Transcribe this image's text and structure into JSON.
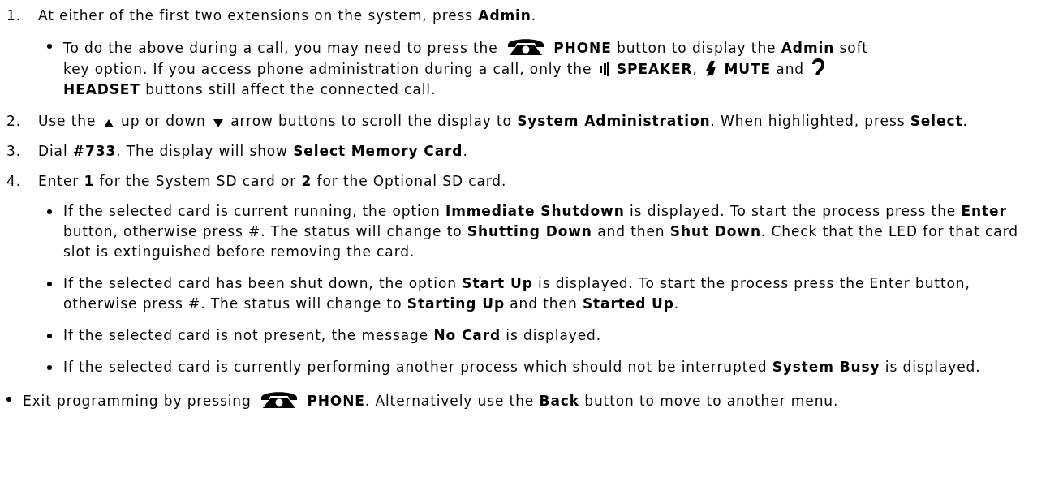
{
  "steps": [
    {
      "number": "1.",
      "segments": [
        {
          "kind": "text",
          "text": "At either of the first two extensions on the system, press **Admin**."
        }
      ],
      "notes": [
        {
          "segments": [
            {
              "kind": "text",
              "text": "To do the above during a call, you may need to press the"
            },
            {
              "kind": "phone_key"
            },
            {
              "kind": "text",
              "text": "**PHONE** button to display the **Admin** soft"
            },
            {
              "kind": "text",
              "text": "key option. If you access phone administration during a call, only the"
            },
            {
              "kind": "speaker_key"
            },
            {
              "kind": "text",
              "text": "**SPEAKER**,"
            },
            {
              "kind": "mute_key"
            },
            {
              "kind": "text",
              "text": "**MUTE** and"
            },
            {
              "kind": "headset_key"
            },
            {
              "kind": "text",
              "text": "**HEADSET** buttons still affect the connected call."
            }
          ]
        }
      ]
    },
    {
      "number": "2.",
      "segments": [
        {
          "kind": "text",
          "text": "Use the"
        },
        {
          "kind": "up_key"
        },
        {
          "kind": "text",
          "text": "up or down"
        },
        {
          "kind": "down_key"
        },
        {
          "kind": "text",
          "text": "arrow buttons to scroll the display to **System Administration**. When highlighted,"
        },
        {
          "kind": "text",
          "text": "press **Select**."
        }
      ]
    },
    {
      "number": "3.",
      "segments": [
        {
          "kind": "text",
          "text": "Dial **#733**. The display will show **Select Memory Card**."
        }
      ]
    },
    {
      "number": "4.",
      "segments": [
        {
          "kind": "text",
          "text": "Enter **1** for the System SD card or **2** for the Optional SD card."
        }
      ],
      "notes": [
        {
          "segments": [
            {
              "kind": "text",
              "text": "If the selected card is current running, the option **Immediate Shutdown** is displayed. To start the process press the **Enter** button, otherwise press #. The status will change to **Shutting Down** and then **Shut Down**. Check that the LED for that card slot is extinguished before removing the card."
            }
          ]
        },
        {
          "segments": [
            {
              "kind": "text",
              "text": "If the selected card has been shut down, the option **Start Up** is displayed. To start the process press the Enter button, otherwise press #. The status will change to **Starting Up** and then **Started Up**."
            }
          ]
        },
        {
          "segments": [
            {
              "kind": "text",
              "text": "If the selected card is not present, the message **No Card** is displayed."
            }
          ]
        },
        {
          "segments": [
            {
              "kind": "text",
              "text": "If the selected card is currently performing another process which should not be interrupted **System Busy** is displayed."
            }
          ]
        }
      ]
    }
  ],
  "final_note": {
    "segments": [
      {
        "kind": "text",
        "text": "Exit programming by pressing"
      },
      {
        "kind": "phone_key"
      },
      {
        "kind": "text",
        "text": "**PHONE**. Alternatively use the **Back** button to move to another menu."
      }
    ]
  }
}
